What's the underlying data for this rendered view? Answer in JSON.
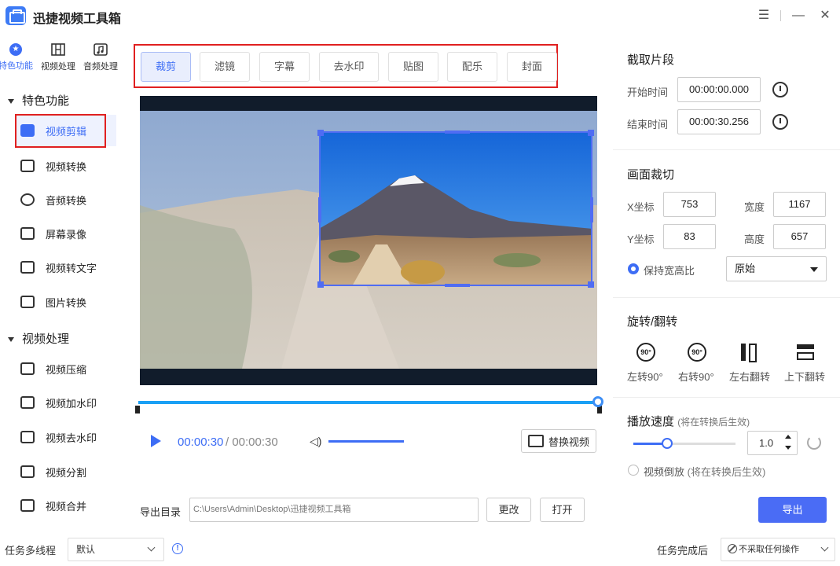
{
  "app": {
    "title": "迅捷视频工具箱"
  },
  "window_controls": {
    "menu": "☰",
    "minimize": "—",
    "close": "✕"
  },
  "top_nav": [
    {
      "label": "特色功能",
      "icon": "star-icon",
      "active": true
    },
    {
      "label": "视频处理",
      "icon": "film-icon",
      "active": false
    },
    {
      "label": "音频处理",
      "icon": "music-icon",
      "active": false
    }
  ],
  "sidebar": {
    "group1": {
      "label": "特色功能"
    },
    "group1_items": [
      {
        "label": "视频剪辑",
        "active": true
      },
      {
        "label": "视频转换"
      },
      {
        "label": "音频转换"
      },
      {
        "label": "屏幕录像"
      },
      {
        "label": "视频转文字"
      },
      {
        "label": "图片转换"
      }
    ],
    "group2": {
      "label": "视频处理"
    },
    "group2_items": [
      {
        "label": "视频压缩"
      },
      {
        "label": "视频加水印"
      },
      {
        "label": "视频去水印"
      },
      {
        "label": "视频分割"
      },
      {
        "label": "视频合并"
      }
    ]
  },
  "tabs": [
    {
      "label": "裁剪",
      "active": true
    },
    {
      "label": "滤镜"
    },
    {
      "label": "字幕"
    },
    {
      "label": "去水印"
    },
    {
      "label": "贴图"
    },
    {
      "label": "配乐"
    },
    {
      "label": "封面"
    }
  ],
  "player": {
    "current_time": "00:00:30",
    "total_time": "/ 00:00:30",
    "progress": 1.0,
    "volume": 1.0,
    "replace_label": "替换视频"
  },
  "export": {
    "dir_label": "导出目录",
    "path": "C:\\Users\\Admin\\Desktop\\迅捷视频工具箱",
    "change_label": "更改",
    "open_label": "打开",
    "export_label": "导出"
  },
  "clip": {
    "title": "截取片段",
    "start_label": "开始时间",
    "start_value": "00:00:00.000",
    "end_label": "结束时间",
    "end_value": "00:00:30.256"
  },
  "crop": {
    "title": "画面裁切",
    "x_label": "X坐标",
    "x_value": "753",
    "w_label": "宽度",
    "w_value": "1167",
    "y_label": "Y坐标",
    "y_value": "83",
    "h_label": "高度",
    "h_value": "657",
    "keep_ratio_label": "保持宽高比",
    "keep_ratio_checked": true,
    "ratio_value": "原始"
  },
  "rotate": {
    "title": "旋转/翻转",
    "items": [
      {
        "label": "左转90°",
        "icon_text": "90°"
      },
      {
        "label": "右转90°",
        "icon_text": "90°"
      },
      {
        "label": "左右翻转"
      },
      {
        "label": "上下翻转"
      }
    ]
  },
  "speed": {
    "title": "播放速度",
    "note": "(将在转换后生效)",
    "value": "1.0",
    "level": 0.3,
    "reverse_label": "视频倒放",
    "reverse_note": "(将在转换后生效)"
  },
  "status": {
    "threads_label": "任务多线程",
    "threads_value": "默认",
    "after_label": "任务完成后",
    "after_value": "不采取任何操作"
  },
  "colors": {
    "accent": "#3d6df5",
    "highlight_box": "#e02020",
    "progress": "#1aa0f5",
    "export_button": "#4a6cf5"
  }
}
